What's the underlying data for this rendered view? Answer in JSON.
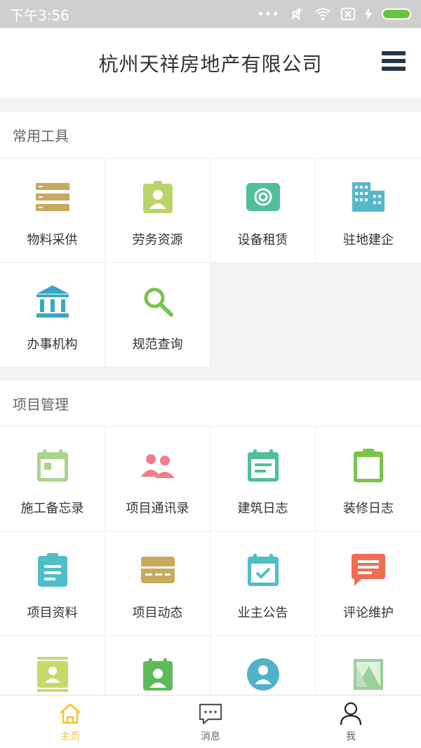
{
  "status_bar": {
    "time": "下午3:56"
  },
  "header": {
    "title": "杭州天祥房地产有限公司"
  },
  "sections": [
    {
      "title": "常用工具",
      "items": [
        {
          "label": "物料采供",
          "icon": "list-icon",
          "color": "#c8a95e"
        },
        {
          "label": "劳务资源",
          "icon": "badge-icon",
          "color": "#b9d46a"
        },
        {
          "label": "设备租赁",
          "icon": "radio-icon",
          "color": "#4fbf9c"
        },
        {
          "label": "驻地建企",
          "icon": "building-icon",
          "color": "#56b8c8"
        },
        {
          "label": "办事机构",
          "icon": "institution-icon",
          "color": "#3aa6c6"
        },
        {
          "label": "规范查询",
          "icon": "search-icon",
          "color": "#7cc34a"
        }
      ]
    },
    {
      "title": "项目管理",
      "items": [
        {
          "label": "施工备忘录",
          "icon": "calendar-icon",
          "color": "#a9d48b"
        },
        {
          "label": "项目通讯录",
          "icon": "contacts-icon",
          "color": "#f17d8a"
        },
        {
          "label": "建筑日志",
          "icon": "log-icon",
          "color": "#4fbf9c"
        },
        {
          "label": "装修日志",
          "icon": "clipboard-icon",
          "color": "#7cc34a"
        },
        {
          "label": "项目资料",
          "icon": "document-icon",
          "color": "#4fbec8"
        },
        {
          "label": "项目动态",
          "icon": "card-icon",
          "color": "#c8a95e"
        },
        {
          "label": "业主公告",
          "icon": "calendar-check-icon",
          "color": "#4fbec8"
        },
        {
          "label": "评论维护",
          "icon": "comment-icon",
          "color": "#ef6d55"
        },
        {
          "label": "",
          "icon": "id-card-icon",
          "color": "#c7d96a"
        },
        {
          "label": "",
          "icon": "id-badge-icon",
          "color": "#5cbb5a"
        },
        {
          "label": "",
          "icon": "user-circle-icon",
          "color": "#4fb2c8"
        },
        {
          "label": "",
          "icon": "image-icon",
          "color": "#9bcf9b"
        }
      ]
    }
  ],
  "tabbar": [
    {
      "label": "主页",
      "icon": "home-icon",
      "active": true
    },
    {
      "label": "消息",
      "icon": "message-icon",
      "active": false
    },
    {
      "label": "我",
      "icon": "user-icon",
      "active": false
    }
  ],
  "colors": {
    "accent": "#f5c32c",
    "header_dark": "#25384a"
  }
}
